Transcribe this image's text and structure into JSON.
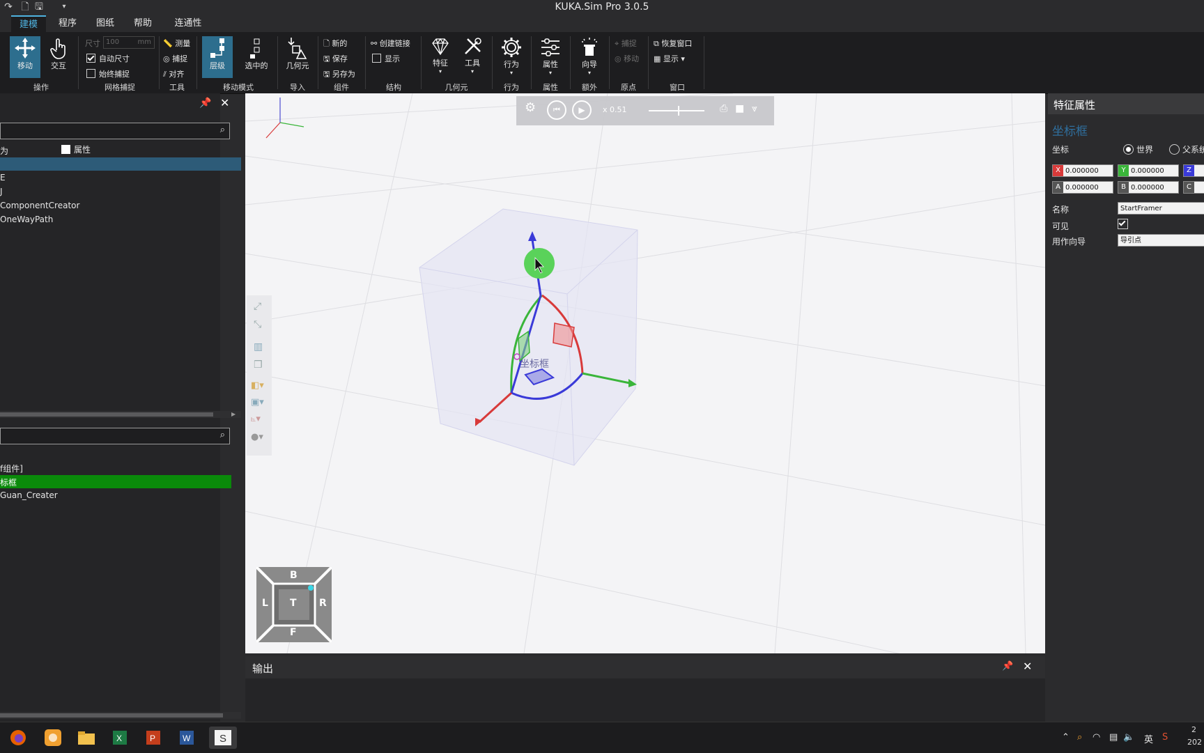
{
  "window": {
    "title": "KUKA.Sim Pro 3.0.5"
  },
  "tabs": [
    {
      "label": "建模",
      "active": true
    },
    {
      "label": "程序"
    },
    {
      "label": "图纸"
    },
    {
      "label": "帮助"
    },
    {
      "label": "连通性"
    }
  ],
  "ribbon": {
    "move_label": "移动",
    "interact_label": "交互",
    "operate_group": "操作",
    "size_label": "尺寸",
    "size_value": "100",
    "size_unit": "mm",
    "auto_size_label": "自动尺寸",
    "always_snap_label": "始终捕捉",
    "grid_snap_group": "网格捕捉",
    "measure_label": "测量",
    "snap_label": "捕捉",
    "align_label": "对齐",
    "tools_group": "工具",
    "hierarchy_label": "层级",
    "selected_label": "选中的",
    "move_mode_group": "移动模式",
    "geometry_label": "几何元",
    "import_group": "导入",
    "new_label": "新的",
    "save_label": "保存",
    "save_as_label": "另存为",
    "component_group": "组件",
    "create_link_label": "创建链接",
    "show_label": "显示",
    "structure_group": "结构",
    "feature_label": "特征",
    "tool_label": "工具",
    "geometry_group": "几何元",
    "behavior_label": "行为",
    "behavior_group": "行为",
    "property_label": "属性",
    "property_group": "属性",
    "wizard_label": "向导",
    "extra_group": "额外",
    "origin_snap_label": "捕捉",
    "origin_move_label": "移动",
    "origin_group": "原点",
    "restore_window_label": "恢复窗口",
    "display_label": "显示 ▾",
    "window_group": "窗口"
  },
  "left_panel": {
    "col_structure": "为",
    "col_property": "属性",
    "tree_items": [
      "E",
      "J",
      "ComponentCreator",
      "OneWayPath"
    ],
    "list_items": [
      "f组件]",
      "标框",
      "Guan_Creater"
    ]
  },
  "playback": {
    "speed": "x  0.51"
  },
  "viewport": {
    "frame_label": "坐标框",
    "navcube": {
      "top": "B",
      "left": "L",
      "center": "T",
      "right": "R",
      "bottom": "F"
    }
  },
  "output": {
    "title": "输出"
  },
  "properties": {
    "title": "特征属性",
    "subtitle": "坐标框",
    "coord_label": "坐标",
    "world_label": "世界",
    "parent_label": "父系统",
    "x": "0.000000",
    "y": "0.000000",
    "z_tag": "Z",
    "a": "0.000000",
    "b": "0.000000",
    "c_tag": "C",
    "name_label": "名称",
    "name_value": "StartFramer",
    "visible_label": "可见",
    "guide_label": "用作向导",
    "guide_value": "导引点"
  },
  "taskbar": {
    "ime": "英",
    "time": "2",
    "date": "202"
  },
  "colors": {
    "accent": "#4fb3e0",
    "selected_row": "#0a8a0a",
    "axis_x": "#d83a3a",
    "axis_y": "#3ab53a",
    "axis_z": "#3a3ad8"
  }
}
